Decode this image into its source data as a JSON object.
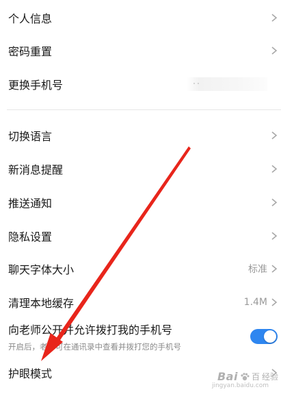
{
  "settings": {
    "items": [
      {
        "label": "个人信息",
        "value": "",
        "chevron": true
      },
      {
        "label": "密码重置",
        "value": "",
        "chevron": true
      },
      {
        "label": "更换手机号",
        "value": "",
        "chevron": false
      },
      {
        "label": "切换语言",
        "value": "",
        "chevron": true
      },
      {
        "label": "新消息提醒",
        "value": "",
        "chevron": true
      },
      {
        "label": "推送通知",
        "value": "",
        "chevron": true
      },
      {
        "label": "隐私设置",
        "value": "",
        "chevron": true
      },
      {
        "label": "聊天字体大小",
        "value": "标准",
        "chevron": true
      },
      {
        "label": "清理本地缓存",
        "value": "1.4M",
        "chevron": true
      },
      {
        "label": "向老师公开并允许拨打我的手机号",
        "value": "",
        "chevron": false
      },
      {
        "label": "护眼模式",
        "value": "",
        "chevron": true
      }
    ],
    "phone_toggle": {
      "sublabel": "开启后，老师可在通讯录中查看并拨打您的手机号",
      "enabled": true
    }
  },
  "icons": {
    "chevron": "chevron-right-icon",
    "annotation": "red-arrow-annotation"
  },
  "colors": {
    "toggle_on": "#2e86f0",
    "annotation_red": "#e8251b",
    "value_gray": "#9a9a9a"
  },
  "watermark": {
    "brand": "Bai",
    "brand_suffix": "百",
    "cn": "经验",
    "url": "jingyan.baidu.com"
  }
}
